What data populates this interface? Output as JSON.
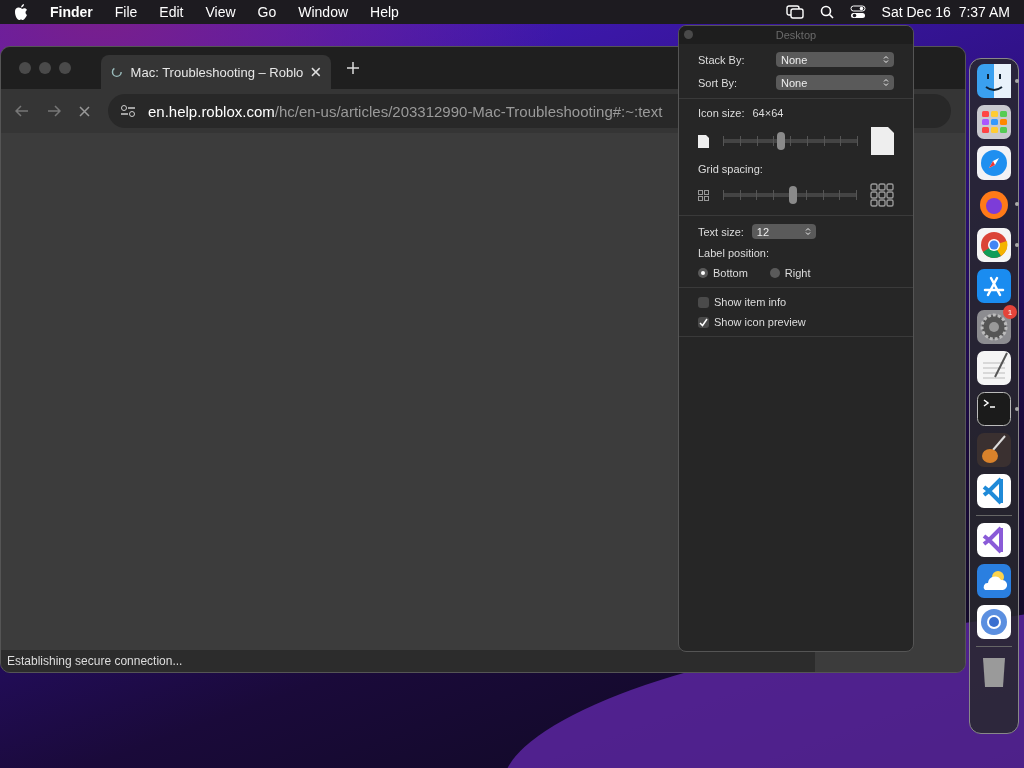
{
  "menu_bar": {
    "items": [
      {
        "label": "Finder",
        "bold": true
      },
      {
        "label": "File",
        "bold": false
      },
      {
        "label": "Edit",
        "bold": false
      },
      {
        "label": "View",
        "bold": false
      },
      {
        "label": "Go",
        "bold": false
      },
      {
        "label": "Window",
        "bold": false
      },
      {
        "label": "Help",
        "bold": false
      }
    ],
    "clock": "Sat Dec 16  7:37 AM"
  },
  "browser": {
    "tab": {
      "title": "Mac: Troubleshooting – Roblo",
      "selected": true
    },
    "url_host": "en.help.roblox.com",
    "url_path": "/hc/en-us/articles/203312990-Mac-Troubleshooting#:~:text",
    "status": "Establishing secure connection..."
  },
  "view_options": {
    "title": "Desktop",
    "stack_by": {
      "label": "Stack By:",
      "value": "None"
    },
    "sort_by": {
      "label": "Sort By:",
      "value": "None"
    },
    "icon_size": {
      "label": "Icon size:",
      "reading": "64×64",
      "level": 0.43
    },
    "grid_spacing": {
      "label": "Grid spacing:",
      "level": 0.53
    },
    "text_size": {
      "label": "Text size:",
      "value": "12"
    },
    "label_position": {
      "label": "Label position:",
      "options": [
        {
          "label": "Bottom",
          "selected": true
        },
        {
          "label": "Right",
          "selected": false
        }
      ]
    },
    "checkboxes": [
      {
        "label": "Show item info",
        "checked": false
      },
      {
        "label": "Show icon preview",
        "checked": true
      }
    ]
  },
  "dock": {
    "items": [
      {
        "kind": "finder",
        "running": true
      },
      {
        "kind": "launchpad",
        "running": false
      },
      {
        "kind": "safari",
        "running": false
      },
      {
        "kind": "firefox",
        "running": true
      },
      {
        "kind": "chrome",
        "running": true
      },
      {
        "kind": "appstore",
        "running": false
      },
      {
        "kind": "settings",
        "running": false,
        "badge": "1"
      },
      {
        "kind": "notes",
        "running": false
      },
      {
        "kind": "terminal",
        "running": true
      },
      {
        "kind": "guitar",
        "running": false
      },
      {
        "kind": "vscode",
        "running": false
      },
      {
        "kind": "divider"
      },
      {
        "kind": "visualstudio",
        "running": false
      },
      {
        "kind": "weather",
        "running": false
      },
      {
        "kind": "chromium",
        "running": false
      },
      {
        "kind": "divider"
      },
      {
        "kind": "trash",
        "running": false
      }
    ]
  }
}
